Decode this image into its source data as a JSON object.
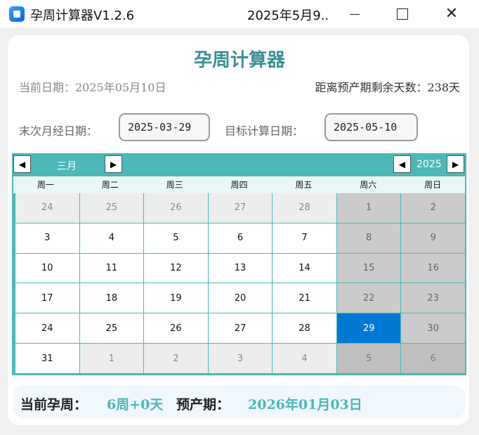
{
  "window": {
    "title": "孕周计算器V1.2.6",
    "subtitle": "2025年5月9...",
    "icons": {
      "minimize": "minimize-icon",
      "maximize": "maximize-icon",
      "close": "close-icon"
    }
  },
  "header": {
    "title": "孕周计算器",
    "current_date": "当前日期：2025年05月10日",
    "days_remaining": "距离预产期剩余天数：238天"
  },
  "inputs": {
    "last_period_label": "末次月经日期：",
    "last_period_value": "2025-03-29",
    "target_label": "目标计算日期：",
    "target_value": "2025-05-10"
  },
  "calendar": {
    "month": "三月",
    "year": "2025",
    "weekdays": [
      "周一",
      "周二",
      "周三",
      "周四",
      "周五",
      "周六",
      "周日"
    ],
    "selected_day": "29",
    "days": [
      [
        "24",
        "25",
        "26",
        "27",
        "28",
        "1",
        "2"
      ],
      [
        "3",
        "4",
        "5",
        "6",
        "7",
        "8",
        "9"
      ],
      [
        "10",
        "11",
        "12",
        "13",
        "14",
        "15",
        "16"
      ],
      [
        "17",
        "18",
        "19",
        "20",
        "21",
        "22",
        "23"
      ],
      [
        "24",
        "25",
        "26",
        "27",
        "28",
        "29",
        "30"
      ],
      [
        "31",
        "1",
        "2",
        "3",
        "4",
        "5",
        "6"
      ]
    ],
    "colors": {
      "header": "#4cb8b8",
      "selected": "#0078d4",
      "weekend": "#cbcbcb"
    }
  },
  "footer": {
    "week_label": "当前孕周：",
    "week_value": "6周+0天",
    "due_label": "预产期：",
    "due_value": "2026年01月03日"
  },
  "colors": {
    "accent": "#4cb8b8",
    "heading": "#3a8f95"
  }
}
